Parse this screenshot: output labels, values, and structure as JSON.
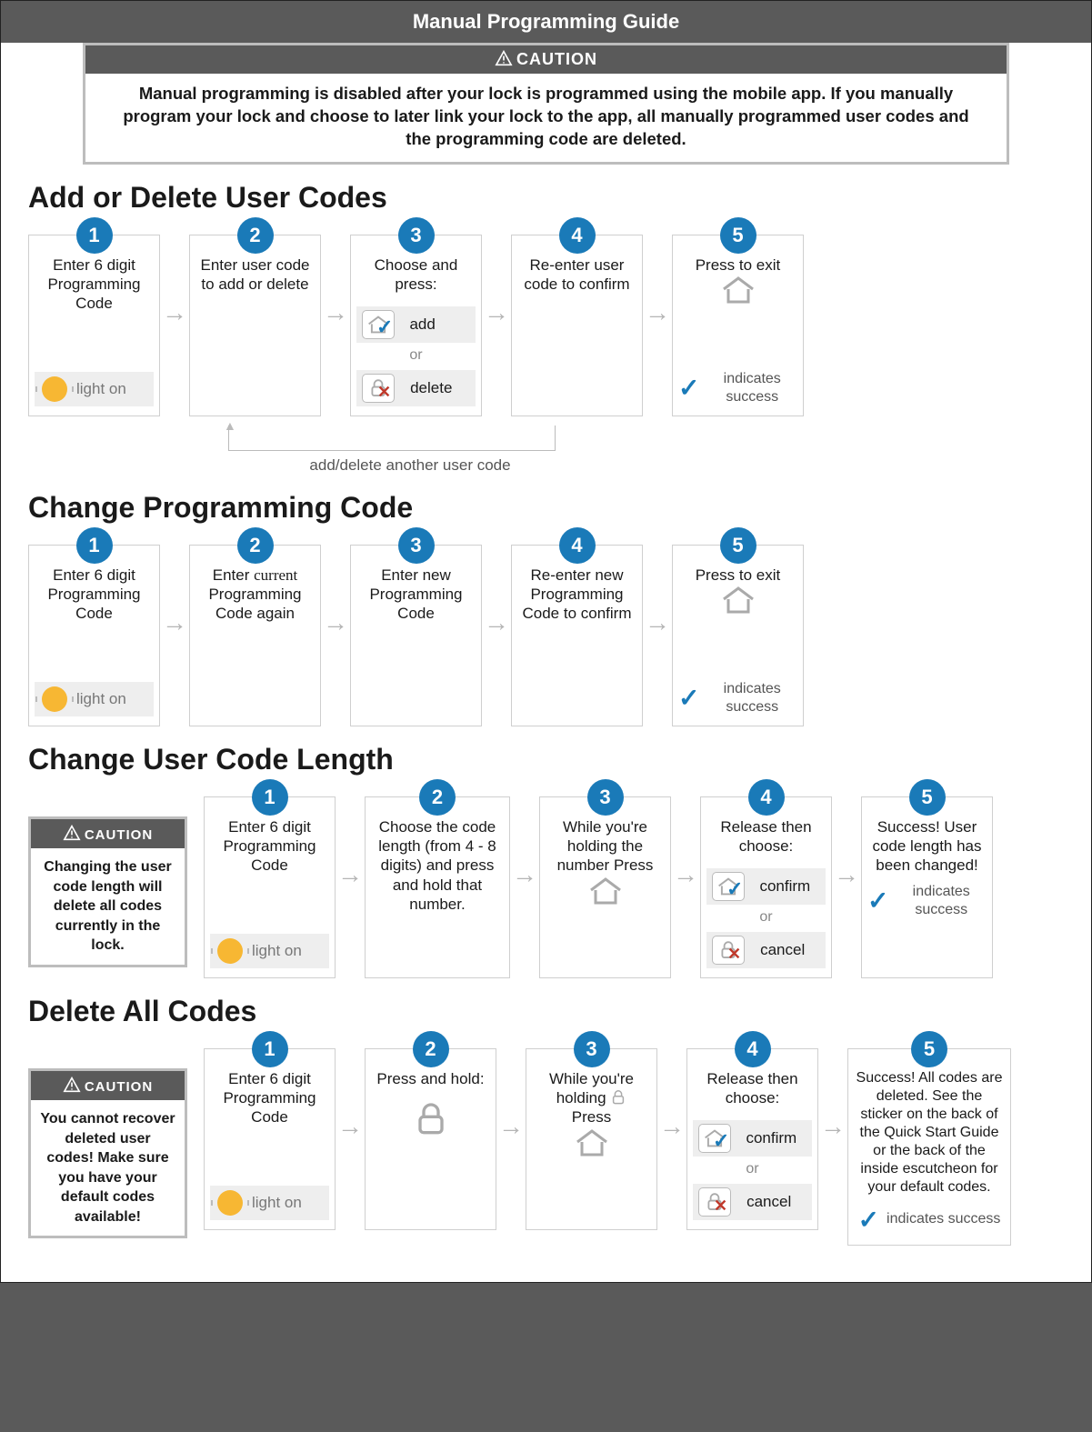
{
  "title": "Manual Programming Guide",
  "caution_label": "CAUTION",
  "caution_text": "Manual programming is disabled after your lock is programmed using the mobile app. If you manually program your lock and choose to later link your lock to the app, all manually programmed user codes and the programming code are deleted.",
  "light_on": "light on",
  "or_label": "or",
  "indicates_success": "indicates success",
  "sections": {
    "add_delete": {
      "heading": "Add or Delete User Codes",
      "steps": [
        "Enter 6 digit Programming Code",
        "Enter user code to add or delete",
        "Choose and press:",
        "Re-enter user code to confirm",
        "Press to exit"
      ],
      "add_label": "add",
      "delete_label": "delete",
      "loop_note": "add/delete another user code"
    },
    "change_prog": {
      "heading": "Change Programming Code",
      "steps_a": "Enter 6 digit Programming Code",
      "steps_b_pre": "Enter ",
      "steps_b_em": "current",
      "steps_b_post": " Programming Code again",
      "steps_c": "Enter new Programming Code",
      "steps_d": "Re-enter new Programming Code to confirm",
      "steps_e": "Press to exit"
    },
    "change_len": {
      "heading": "Change User Code Length",
      "caution": "Changing the user code length will delete all codes currently in the lock.",
      "steps": [
        "Enter 6 digit Programming Code",
        "Choose the code length (from 4 - 8 digits) and press and hold that number.",
        "While you're holding the number Press",
        "Release then choose:",
        "Success! User code length has been changed!"
      ],
      "confirm_label": "confirm",
      "cancel_label": "cancel"
    },
    "delete_all": {
      "heading": "Delete All Codes",
      "caution": "You cannot recover deleted user codes! Make sure you have your default codes available!",
      "steps": [
        "Enter 6 digit Programming Code",
        "Press and hold:",
        "While you're holding",
        "Press",
        "Release then choose:",
        "Success! All codes are deleted. See the sticker on the back of the Quick Start Guide or the back of the inside escutcheon for your default codes."
      ],
      "confirm_label": "confirm",
      "cancel_label": "cancel"
    }
  }
}
